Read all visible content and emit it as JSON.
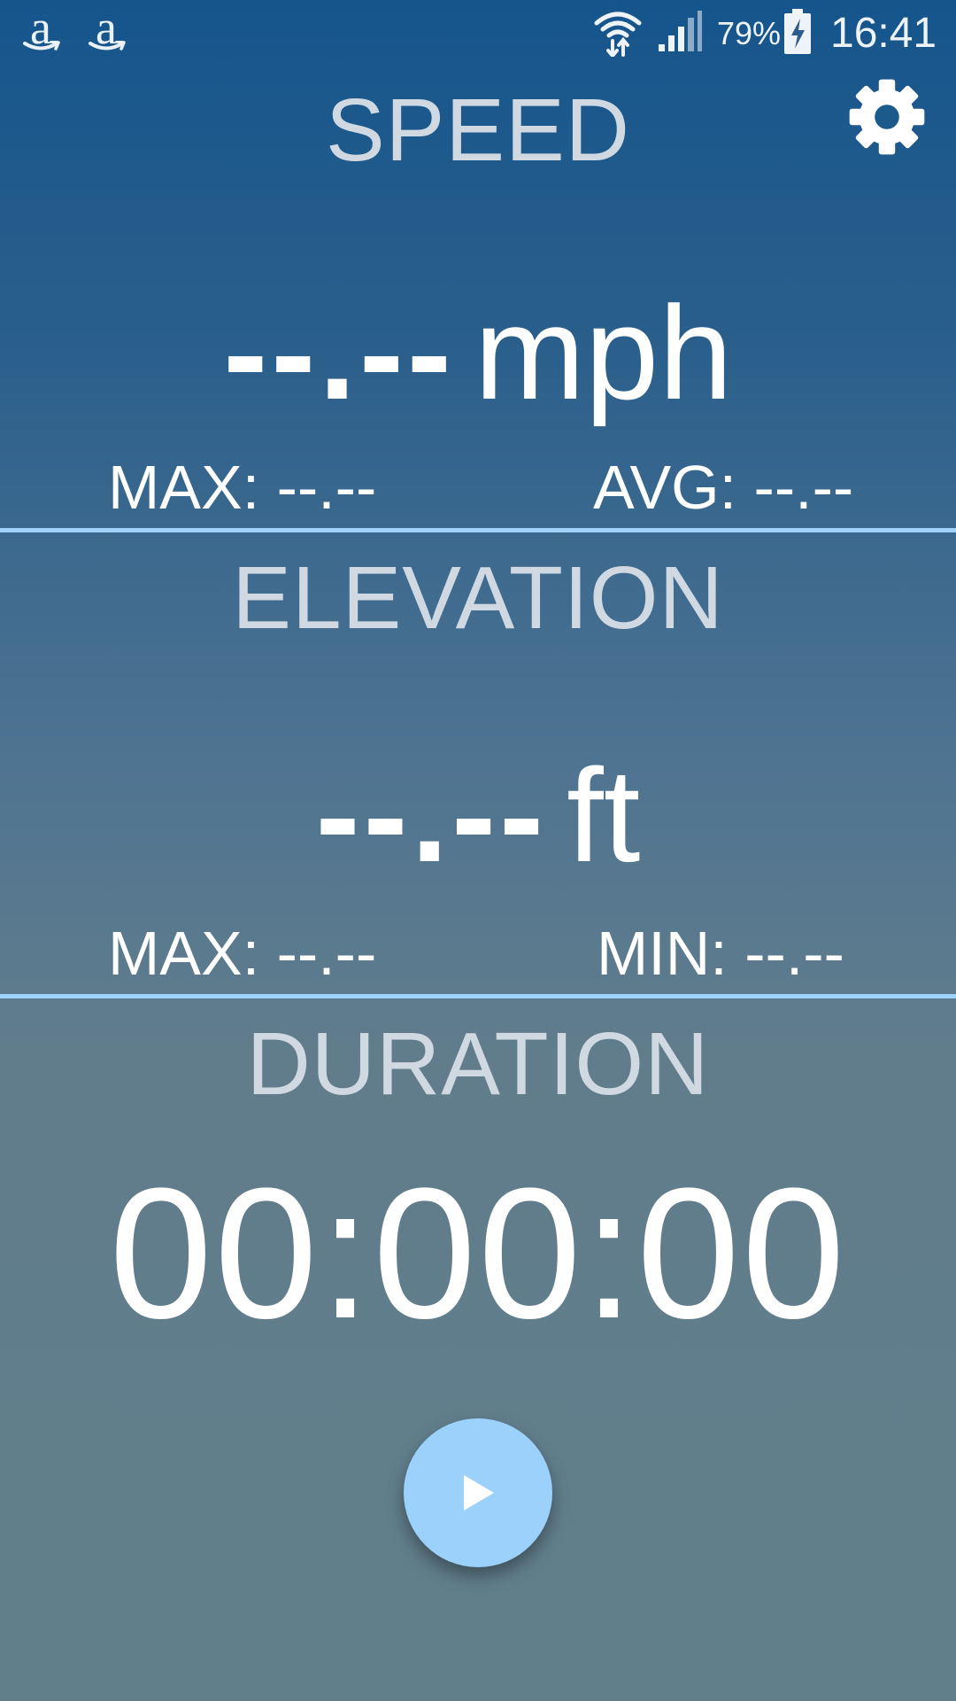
{
  "status_bar": {
    "notification_icons": [
      "amazon-icon",
      "amazon-icon"
    ],
    "amazon_glyph": "a",
    "wifi_icon": "wifi-icon",
    "signal_icon": "cell-signal-icon",
    "battery_percent": "79%",
    "battery_icon": "battery-charging-icon",
    "time": "16:41"
  },
  "toolbar": {
    "settings_icon": "gear-icon"
  },
  "speed": {
    "title": "SPEED",
    "value": "--.--",
    "unit": "mph",
    "max_label": "MAX: --.--",
    "avg_label": "AVG: --.--"
  },
  "elevation": {
    "title": "ELEVATION",
    "value": "--.--",
    "unit": "ft",
    "max_label": "MAX: --.--",
    "min_label": "MIN: --.--"
  },
  "duration": {
    "title": "DURATION",
    "value": "00:00:00"
  },
  "controls": {
    "play_icon": "play-icon"
  },
  "colors": {
    "background_top": "#15558c",
    "background_bottom": "#617e8b",
    "divider": "#9fd3fb",
    "title_text": "#d0d9e2",
    "play_button": "#9bd1fa"
  }
}
